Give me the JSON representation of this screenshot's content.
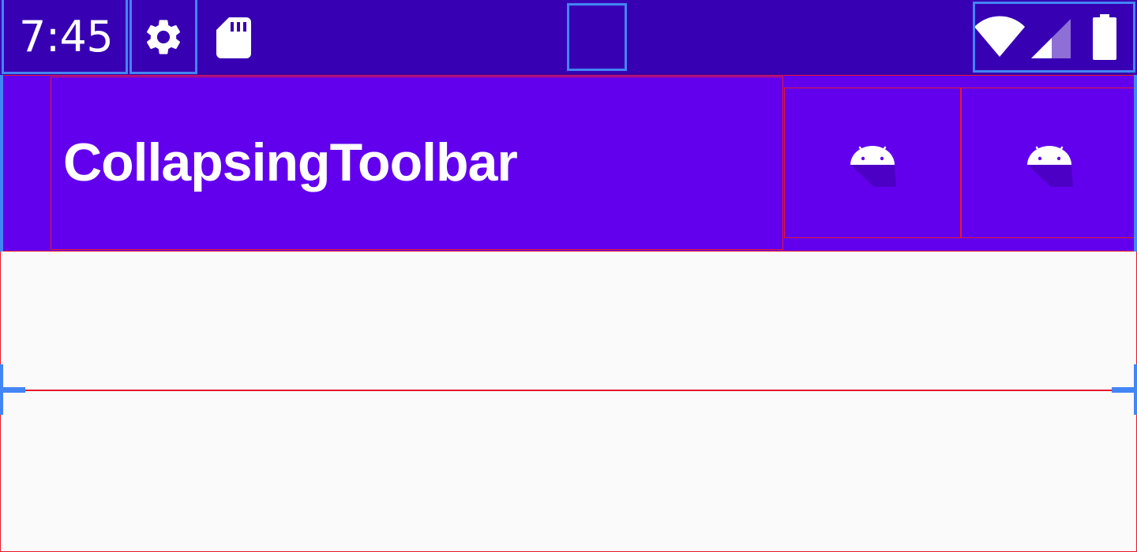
{
  "status_bar": {
    "time": "7:45",
    "left_icons": [
      "gear-icon",
      "sd-card-icon"
    ],
    "right_icons": [
      "wifi-icon",
      "cell-signal-icon",
      "battery-icon"
    ],
    "background_color": "#3700b3"
  },
  "toolbar": {
    "title": "CollapsingToolbar",
    "actions": [
      {
        "icon": "android-icon"
      },
      {
        "icon": "android-icon"
      }
    ],
    "background_color": "#6200ee"
  },
  "content": {
    "background_color": "#fafafa"
  },
  "colors": {
    "primary": "#6200ee",
    "primary_dark": "#3700b3",
    "overlay_red": "#e8192c",
    "overlay_blue": "#4285f4"
  }
}
